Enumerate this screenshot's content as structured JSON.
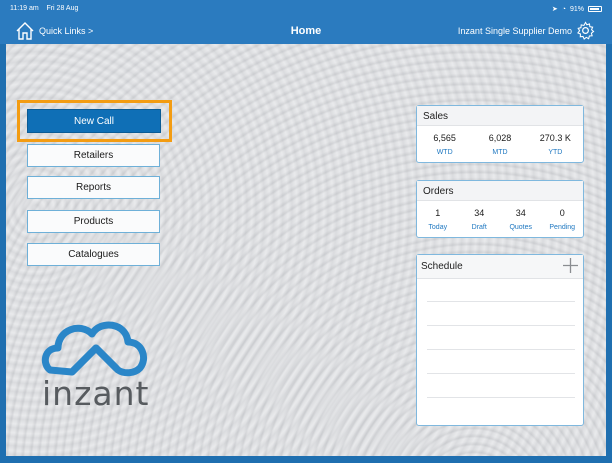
{
  "status_bar": {
    "time": "11:19 am",
    "date": "Fri 28 Aug",
    "battery": "91%"
  },
  "nav": {
    "quick_links": "Quick Links >",
    "title": "Home",
    "tenant": "Inzant Single Supplier Demo"
  },
  "menu": {
    "new_call": "New Call",
    "retailers": "Retailers",
    "reports": "Reports",
    "products": "Products",
    "catalogues": "Catalogues"
  },
  "logo": {
    "text": "inzant"
  },
  "sales": {
    "title": "Sales",
    "items": [
      {
        "value": "6,565",
        "label": "WTD"
      },
      {
        "value": "6,028",
        "label": "MTD"
      },
      {
        "value": "270.3 K",
        "label": "YTD"
      }
    ]
  },
  "orders": {
    "title": "Orders",
    "items": [
      {
        "value": "1",
        "label": "Today"
      },
      {
        "value": "34",
        "label": "Draft"
      },
      {
        "value": "34",
        "label": "Quotes"
      },
      {
        "value": "0",
        "label": "Pending"
      }
    ]
  },
  "schedule": {
    "title": "Schedule"
  },
  "colors": {
    "accent": "#0f6fb6",
    "bar": "#2b7bbf",
    "highlight": "#f39c12",
    "link": "#1f78c1"
  }
}
